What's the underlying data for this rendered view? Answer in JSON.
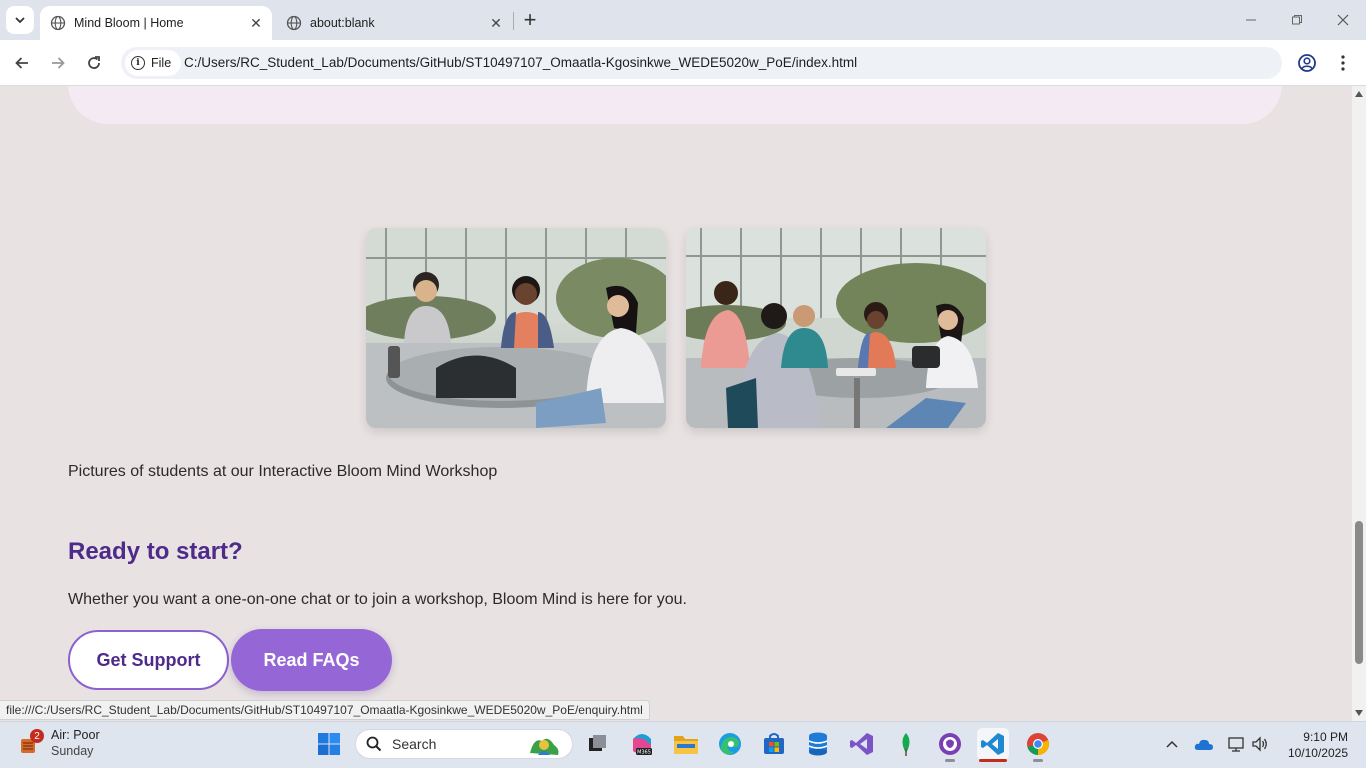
{
  "browser": {
    "tabs": [
      {
        "title": "Mind Bloom | Home",
        "active": true
      },
      {
        "title": "about:blank",
        "active": false
      }
    ],
    "address": {
      "scheme_label": "File",
      "url": "C:/Users/RC_Student_Lab/Documents/GitHub/ST10497107_Omaatla-Kgosinkwe_WEDE5020w_PoE/index.html"
    },
    "status_link": "file:///C:/Users/RC_Student_Lab/Documents/GitHub/ST10497107_Omaatla-Kgosinkwe_WEDE5020w_PoE/enquiry.html"
  },
  "page": {
    "photos": [
      {
        "name": "students-workshop-photo-1"
      },
      {
        "name": "students-workshop-photo-2"
      }
    ],
    "caption": "Pictures of students at our Interactive Bloom Mind Workshop",
    "cta": {
      "heading": "Ready to start?",
      "text": "Whether you want a one-on-one chat or to join a workshop, Bloom Mind is here for you.",
      "support_label": "Get Support",
      "faq_label": "Read FAQs"
    },
    "colors": {
      "accent_purple": "#9567d6",
      "heading_purple": "#4e2a8a",
      "page_bg": "#e8e2e2"
    }
  },
  "taskbar": {
    "weather": {
      "badge": "2",
      "line1": "Air: Poor",
      "line2": "Sunday"
    },
    "search_placeholder": "Search",
    "apps": [
      "windows-start",
      "task-view",
      "m365-copilot",
      "file-explorer",
      "edge",
      "microsoft-store",
      "azure-data-studio",
      "visual-studio",
      "mongodb-compass",
      "github-desktop",
      "vs-code",
      "chrome"
    ],
    "clock": {
      "time": "9:10 PM",
      "date": "10/10/2025"
    }
  }
}
